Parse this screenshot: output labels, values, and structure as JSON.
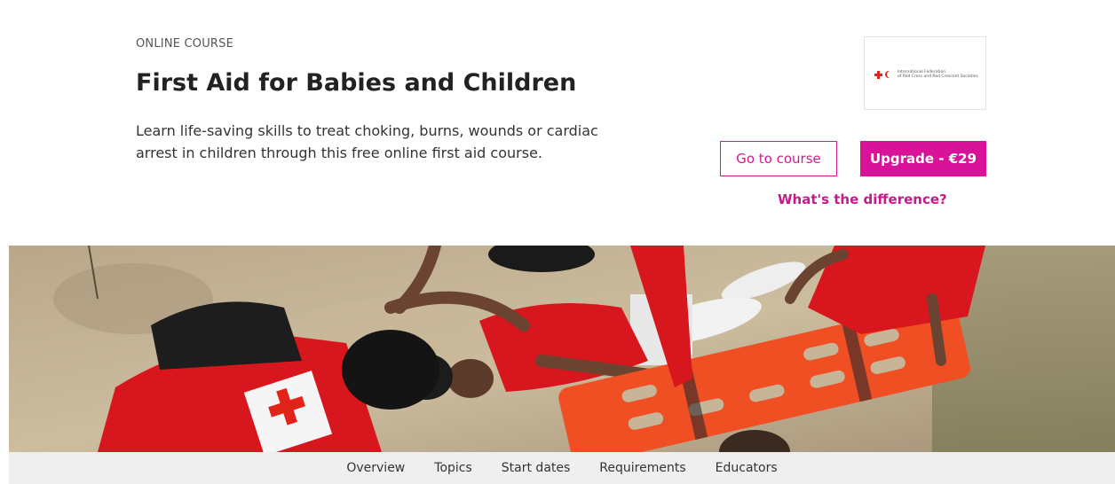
{
  "course": {
    "eyebrow": "ONLINE COURSE",
    "title": "First Aid for Babies and Children",
    "description": "Learn life-saving skills to treat choking, burns, wounds or cardiac arrest in children through this free online first aid course."
  },
  "partner": {
    "name_line1": "International Federation",
    "name_line2": "of Red Cross and Red Crescent Societies"
  },
  "actions": {
    "go_to_course": "Go to course",
    "upgrade": "Upgrade - €29",
    "difference": "What's the difference?"
  },
  "subnav": {
    "items": [
      "Overview",
      "Topics",
      "Start dates",
      "Requirements",
      "Educators"
    ]
  },
  "colors": {
    "accent": "#d8139a",
    "red_cross": "#e2231a",
    "stretcher": "#f04e23"
  }
}
